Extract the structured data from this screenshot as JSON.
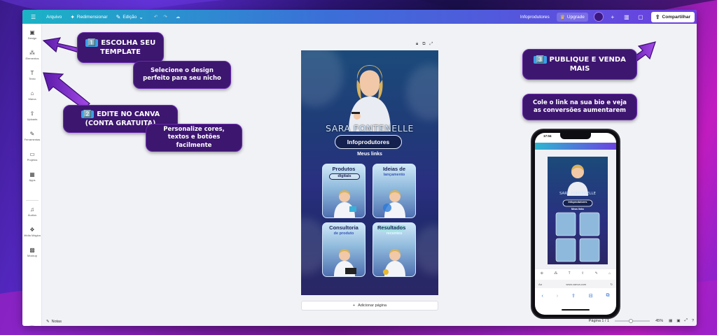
{
  "topbar": {
    "menu_icon": "hamburger-icon",
    "file": "Arquivo",
    "resize": "Redimensionar",
    "edit": "Edição",
    "project_name": "Infoprodutores",
    "upgrade": "Upgrade",
    "share": "Compartilhar"
  },
  "sidebar": {
    "items": [
      {
        "label": "Design",
        "icon": "layout-icon"
      },
      {
        "label": "Elementos",
        "icon": "shapes-icon"
      },
      {
        "label": "Texto",
        "icon": "text-icon"
      },
      {
        "label": "Marca",
        "icon": "brand-icon"
      },
      {
        "label": "Uploads",
        "icon": "upload-icon"
      },
      {
        "label": "Ferramentas",
        "icon": "draw-icon"
      },
      {
        "label": "Projetos",
        "icon": "folder-icon"
      },
      {
        "label": "Apps",
        "icon": "apps-icon"
      },
      {
        "label": "Áudios",
        "icon": "music-icon"
      },
      {
        "label": "Mídia Mágica",
        "icon": "magic-media-icon"
      },
      {
        "label": "Mockup",
        "icon": "mockup-icon"
      }
    ]
  },
  "footer": {
    "notes": "Notas",
    "page_indicator": "Página 1 / 1",
    "zoom": "45%"
  },
  "design": {
    "name": "SARA FONTENELLE",
    "pill": "Infoprodutores",
    "links_title": "Meus links",
    "cards": [
      {
        "title": "Produtos",
        "subtitle": "digitais"
      },
      {
        "title": "Ideias de",
        "subtitle": "lançamento"
      },
      {
        "title": "Consultoria",
        "subtitle": "de produto"
      },
      {
        "title": "Resultados",
        "subtitle": "recentes"
      }
    ],
    "add_page": "Adicionar página"
  },
  "callouts": {
    "step1_num": "1️⃣",
    "step1": "ESCOLHA SEU TEMPLATE",
    "step1_desc": "Selecione o design perfeito para seu nicho",
    "step2_num": "2️⃣",
    "step2": "EDITE NO CANVA (CONTA GRATUITA)",
    "step2_desc": "Personalize cores, textos e botões facilmente",
    "step3_num": "3️⃣",
    "step3": "PUBLIQUE E VENDA MAIS",
    "step3_desc": "Cole o link na sua bio e veja as conversões aumentarem"
  },
  "phone": {
    "time": "17:04",
    "url": "www.canva.com",
    "name": "SARA FONTENELLE",
    "pill": "Infoprodutores",
    "links_title": "Meus links"
  },
  "colors": {
    "topbar_start": "#1bb3c6",
    "topbar_end": "#6d3fe0",
    "callout_bg": "#3d1670",
    "arrow": "#8a2ed8"
  }
}
